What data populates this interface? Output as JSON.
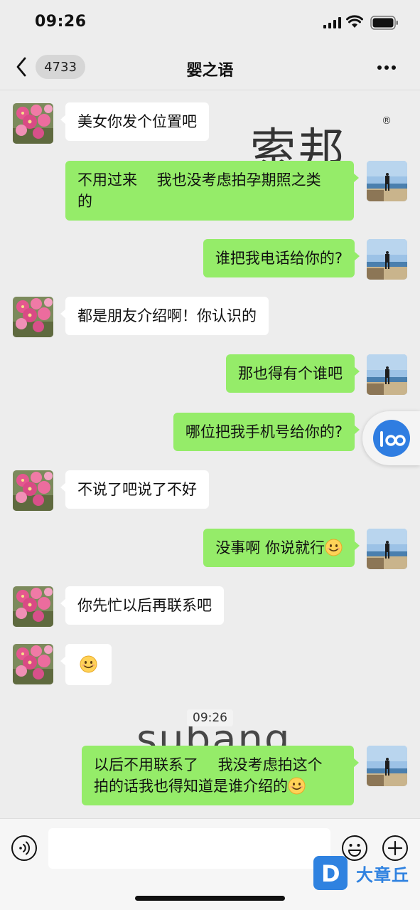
{
  "status_bar": {
    "time": "09:26"
  },
  "nav": {
    "back_badge": "4733",
    "title": "婴之语"
  },
  "watermarks": {
    "brand_cn": "索邦",
    "brand_latin": "subang",
    "reg_mark": "®"
  },
  "messages": [
    {
      "side": "in",
      "text": "美女你发个位置吧"
    },
    {
      "side": "out",
      "line1": "不用过来　 我也没考虑拍孕期照之类",
      "line2": "的"
    },
    {
      "side": "out",
      "text": "谁把我电话给你的?"
    },
    {
      "side": "in",
      "text": "都是朋友介绍啊！你认识的"
    },
    {
      "side": "out",
      "text": "那也得有个谁吧"
    },
    {
      "side": "out",
      "text": "哪位把我手机号给你的?"
    },
    {
      "side": "in",
      "text": "不说了吧说了不好"
    },
    {
      "side": "out",
      "text": "没事啊  你说就行",
      "emoji": "smile"
    },
    {
      "side": "in",
      "text": "你先忙以后再联系吧"
    },
    {
      "side": "in",
      "text": "",
      "emoji": "smile"
    },
    {
      "side": "out",
      "line1": "以后不用联系了 　我没考虑拍这个",
      "line2": "拍的话我也得知道是谁介绍的",
      "emoji": "smile"
    }
  ],
  "time_divider": "09:26",
  "input": {
    "placeholder": ""
  },
  "corner_logo": {
    "letter": "D",
    "text": "大章丘"
  },
  "colors": {
    "background": "#ededed",
    "outgoing_bubble": "#95ec69",
    "incoming_bubble": "#ffffff",
    "logo": "#2f82e0"
  },
  "icons": [
    "signal-icon",
    "wifi-icon",
    "battery-icon",
    "back-chevron-icon",
    "more-icon",
    "voice-icon",
    "emoji-icon",
    "plus-icon",
    "smile-emoji-icon"
  ]
}
